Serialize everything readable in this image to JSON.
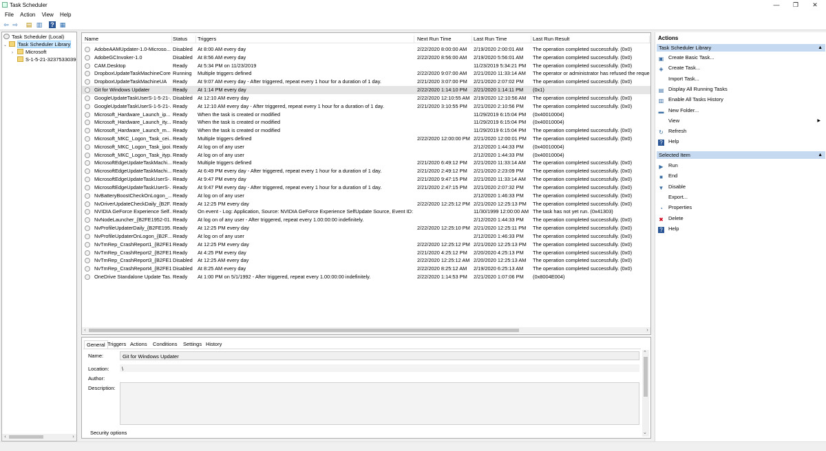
{
  "window": {
    "title": "Task Scheduler",
    "minimize": "—",
    "maximize": "❐",
    "close": "✕"
  },
  "menu": [
    "File",
    "Action",
    "View",
    "Help"
  ],
  "toolbar": {
    "back": "⇦",
    "forward": "⇨",
    "up": "▤",
    "properties": "▥",
    "help": "?",
    "show": "▦"
  },
  "tree": {
    "root": "Task Scheduler (Local)",
    "library": "Task Scheduler Library",
    "children": [
      "Microsoft",
      "S-1-5-21-3237533039-"
    ]
  },
  "columns": [
    "Name",
    "Status",
    "Triggers",
    "Next Run Time",
    "Last Run Time",
    "Last Run Result"
  ],
  "tasks": [
    [
      "AdobeAAMUpdater-1.0-Microso...",
      "Disabled",
      "At 8:00 AM every day",
      "2/22/2020 8:00:00 AM",
      "2/19/2020 2:00:01 AM",
      "The operation completed successfully. (0x0)"
    ],
    [
      "AdobeGCInvoker-1.0",
      "Disabled",
      "At 8:56 AM every day",
      "2/22/2020 8:56:00 AM",
      "2/19/2020 5:56:01 AM",
      "The operation completed successfully. (0x0)"
    ],
    [
      "CAM.Desktop",
      "Ready",
      "At 5:34 PM on 11/23/2019",
      "",
      "11/23/2019 5:34:21 PM",
      "The operation completed successfully. (0x0)"
    ],
    [
      "DropboxUpdateTaskMachineCore",
      "Running",
      "Multiple triggers defined",
      "2/22/2020 9:07:00 AM",
      "2/21/2020 11:33:14 AM",
      "The operator or administrator has refused the reques"
    ],
    [
      "DropboxUpdateTaskMachineUA",
      "Ready",
      "At 9:07 AM every day - After triggered, repeat every 1 hour for a duration of 1 day.",
      "2/21/2020 3:07:00 PM",
      "2/21/2020 2:07:02 PM",
      "The operation completed successfully. (0x0)"
    ],
    [
      "Git for Windows Updater",
      "Ready",
      "At 1:14 PM every day",
      "2/22/2020 1:14:10 PM",
      "2/21/2020 1:14:11 PM",
      "(0x1)"
    ],
    [
      "GoogleUpdateTaskUserS-1-5-21-...",
      "Disabled",
      "At 12:10 AM every day",
      "2/22/2020 12:10:55 AM",
      "2/19/2020 12:10:56 AM",
      "The operation completed successfully. (0x0)"
    ],
    [
      "GoogleUpdateTaskUserS-1-5-21-...",
      "Ready",
      "At 12:10 AM every day - After triggered, repeat every 1 hour for a duration of 1 day.",
      "2/21/2020 3:10:55 PM",
      "2/21/2020 2:10:56 PM",
      "The operation completed successfully. (0x0)"
    ],
    [
      "Microsoft_Hardware_Launch_ip...",
      "Ready",
      "When the task is created or modified",
      "",
      "11/29/2019 6:15:04 PM",
      "(0x40010004)"
    ],
    [
      "Microsoft_Hardware_Launch_ity...",
      "Ready",
      "When the task is created or modified",
      "",
      "11/29/2019 6:15:04 PM",
      "(0x40010004)"
    ],
    [
      "Microsoft_Hardware_Launch_m...",
      "Ready",
      "When the task is created or modified",
      "",
      "11/29/2019 6:15:04 PM",
      "The operation completed successfully. (0x0)"
    ],
    [
      "Microsoft_MKC_Logon_Task_cei...",
      "Ready",
      "Multiple triggers defined",
      "2/22/2020 12:00:00 PM",
      "2/21/2020 12:00:01 PM",
      "The operation completed successfully. (0x0)"
    ],
    [
      "Microsoft_MKC_Logon_Task_ipoi...",
      "Ready",
      "At log on of any user",
      "",
      "2/12/2020 1:44:33 PM",
      "(0x40010004)"
    ],
    [
      "Microsoft_MKC_Logon_Task_ityp...",
      "Ready",
      "At log on of any user",
      "",
      "2/12/2020 1:44:33 PM",
      "(0x40010004)"
    ],
    [
      "MicrosoftEdgeUpdateTaskMachi...",
      "Ready",
      "Multiple triggers defined",
      "2/21/2020 6:49:12 PM",
      "2/21/2020 11:33:14 AM",
      "The operation completed successfully. (0x0)"
    ],
    [
      "MicrosoftEdgeUpdateTaskMachi...",
      "Ready",
      "At 6:49 PM every day - After triggered, repeat every 1 hour for a duration of 1 day.",
      "2/21/2020 2:49:12 PM",
      "2/21/2020 2:23:09 PM",
      "The operation completed successfully. (0x0)"
    ],
    [
      "MicrosoftEdgeUpdateTaskUserS-...",
      "Ready",
      "At 9:47 PM every day",
      "2/21/2020 9:47:15 PM",
      "2/21/2020 11:33:14 AM",
      "The operation completed successfully. (0x0)"
    ],
    [
      "MicrosoftEdgeUpdateTaskUserS-...",
      "Ready",
      "At 9:47 PM every day - After triggered, repeat every 1 hour for a duration of 1 day.",
      "2/21/2020 2:47:15 PM",
      "2/21/2020 2:07:32 PM",
      "The operation completed successfully. (0x0)"
    ],
    [
      "NvBatteryBoostCheckOnLogon_...",
      "Ready",
      "At log on of any user",
      "",
      "2/12/2020 1:46:33 PM",
      "The operation completed successfully. (0x0)"
    ],
    [
      "NvDriverUpdateCheckDaily_{B2F...",
      "Ready",
      "At 12:25 PM every day",
      "2/22/2020 12:25:12 PM",
      "2/21/2020 12:25:13 PM",
      "The operation completed successfully. (0x0)"
    ],
    [
      "NVIDIA GeForce Experience Self...",
      "Ready",
      "On event - Log: Application, Source: NVIDIA GeForce Experience SelfUpdate Source, Event ID: 0",
      "",
      "11/30/1999 12:00:00 AM",
      "The task has not yet run. (0x41303)"
    ],
    [
      "NvNodeLauncher_{B2FE1952-01...",
      "Ready",
      "At log on of any user - After triggered, repeat every 1.00:00:00 indefinitely.",
      "",
      "2/12/2020 1:44:33 PM",
      "The operation completed successfully. (0x0)"
    ],
    [
      "NvProfileUpdaterDaily_{B2FE195...",
      "Ready",
      "At 12:25 PM every day",
      "2/22/2020 12:25:10 PM",
      "2/21/2020 12:25:11 PM",
      "The operation completed successfully. (0x0)"
    ],
    [
      "NvProfileUpdaterOnLogon_{B2F...",
      "Ready",
      "At log on of any user",
      "",
      "2/12/2020 1:46:33 PM",
      "The operation completed successfully. (0x0)"
    ],
    [
      "NvTmRep_CrashReport1_{B2FE1...",
      "Ready",
      "At 12:25 PM every day",
      "2/22/2020 12:25:12 PM",
      "2/21/2020 12:25:13 PM",
      "The operation completed successfully. (0x0)"
    ],
    [
      "NvTmRep_CrashReport2_{B2FE1...",
      "Ready",
      "At 4:25 PM every day",
      "2/21/2020 4:25:12 PM",
      "2/20/2020 4:25:13 PM",
      "The operation completed successfully. (0x0)"
    ],
    [
      "NvTmRep_CrashReport3_{B2FE1...",
      "Disabled",
      "At 12:25 AM every day",
      "2/22/2020 12:25:12 AM",
      "2/20/2020 12:25:13 AM",
      "The operation completed successfully. (0x0)"
    ],
    [
      "NvTmRep_CrashReport4_{B2FE1...",
      "Disabled",
      "At 8:25 AM every day",
      "2/22/2020 8:25:12 AM",
      "2/19/2020 6:25:13 AM",
      "The operation completed successfully. (0x0)"
    ],
    [
      "OneDrive Standalone Update Tas...",
      "Ready",
      "At 1:00 PM on 5/1/1992 - After triggered, repeat every 1.00:00:00 indefinitely.",
      "2/22/2020 1:14:53 PM",
      "2/21/2020 1:07:06 PM",
      "(0x8004E004)"
    ]
  ],
  "selected_row": 5,
  "detail_tabs": [
    "General",
    "Triggers",
    "Actions",
    "Conditions",
    "Settings",
    "History (disabled)"
  ],
  "general": {
    "name_label": "Name:",
    "name_value": "Git for Windows Updater",
    "location_label": "Location:",
    "location_value": "\\",
    "author_label": "Author:",
    "description_label": "Description:",
    "security_label": "Security options"
  },
  "actions": {
    "title": "Actions",
    "library_header": "Task Scheduler Library",
    "library_items": [
      {
        "label": "Create Basic Task...",
        "icon": "create-basic-task-icon",
        "glyph": "▣"
      },
      {
        "label": "Create Task...",
        "icon": "create-task-icon",
        "glyph": "◈"
      },
      {
        "label": "Import Task...",
        "icon": "",
        "glyph": ""
      },
      {
        "label": "Display All Running Tasks",
        "icon": "running-tasks-icon",
        "glyph": "▤"
      },
      {
        "label": "Enable All Tasks History",
        "icon": "history-icon",
        "glyph": "▥"
      },
      {
        "label": "New Folder...",
        "icon": "folder-icon",
        "glyph": "▬"
      },
      {
        "label": "View",
        "icon": "",
        "glyph": "",
        "submenu": "▶"
      },
      {
        "label": "Refresh",
        "icon": "refresh-icon",
        "glyph": "↻"
      },
      {
        "label": "Help",
        "icon": "help-icon",
        "glyph": "?"
      }
    ],
    "selected_header": "Selected Item",
    "selected_items": [
      {
        "label": "Run",
        "icon": "run-icon",
        "glyph": "▶"
      },
      {
        "label": "End",
        "icon": "end-icon",
        "glyph": "■"
      },
      {
        "label": "Disable",
        "icon": "disable-icon",
        "glyph": "▼"
      },
      {
        "label": "Export...",
        "icon": "",
        "glyph": ""
      },
      {
        "label": "Properties",
        "icon": "properties-icon",
        "glyph": "◔"
      },
      {
        "label": "Delete",
        "icon": "delete-icon",
        "glyph": "✖"
      },
      {
        "label": "Help",
        "icon": "help-icon",
        "glyph": "?"
      }
    ]
  },
  "colors": {
    "section_header": "#c5d9f0",
    "delete": "#d0021b",
    "selected_row": "#e5e5e5",
    "tree_selection": "#cce8ff"
  }
}
